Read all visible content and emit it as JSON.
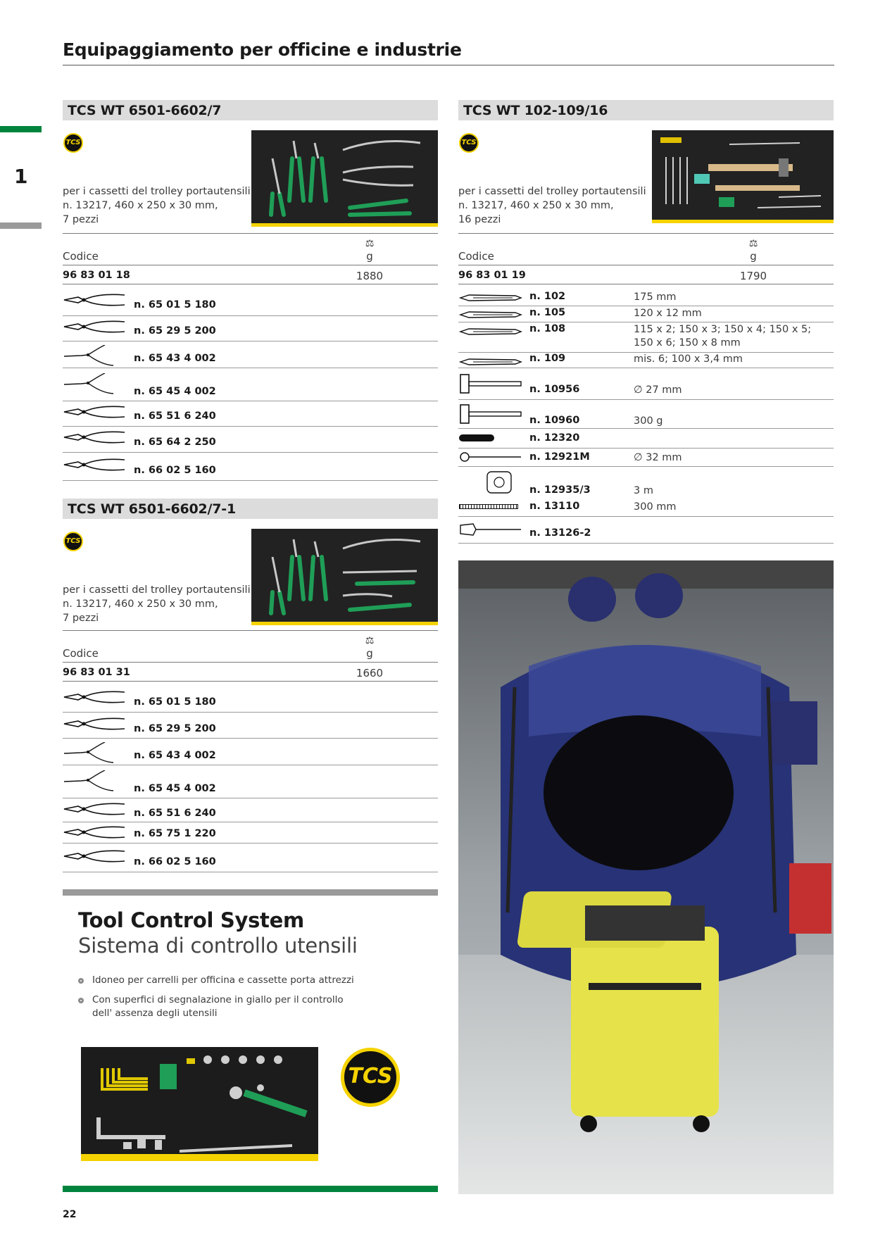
{
  "page": {
    "title": "Equipaggiamento per officine e industrie",
    "chapter": "1",
    "page_number": "22"
  },
  "colors": {
    "accent_green": "#00843d",
    "tcs_yellow": "#f5d300",
    "header_gray": "#dcdcdc"
  },
  "badge_text": "TCS",
  "sets": [
    {
      "heading": "TCS WT 6501-6602/7",
      "description": "per i cassetti del trolley portautensili\nn. 13217, 460 x 250 x 30 mm,\n7 pezzi",
      "codice_label": "Codice",
      "unit": "g",
      "code": "96 83 01 18",
      "weight": "1880",
      "items": [
        {
          "icon": "combination-pliers-icon",
          "ref": "n. 65 01 5 180"
        },
        {
          "icon": "long-nose-pliers-icon",
          "ref": "n. 65 29 5 200"
        },
        {
          "icon": "circlip-pliers-icon",
          "ref": "n. 65 43 4 002"
        },
        {
          "icon": "circlip-pliers-icon",
          "ref": "n. 65 45 4 002"
        },
        {
          "icon": "water-pump-pliers-icon",
          "ref": "n. 65 51 6 240"
        },
        {
          "icon": "locking-pliers-icon",
          "ref": "n. 65 64 2 250"
        },
        {
          "icon": "side-cutter-icon",
          "ref": "n. 66 02 5 160"
        }
      ]
    },
    {
      "heading": "TCS WT 6501-6602/7-1",
      "description": "per i cassetti del trolley portautensili\nn. 13217, 460 x 250 x 30 mm,\n7 pezzi",
      "codice_label": "Codice",
      "unit": "g",
      "code": "96 83 01 31",
      "weight": "1660",
      "items": [
        {
          "icon": "combination-pliers-icon",
          "ref": "n. 65 01 5 180"
        },
        {
          "icon": "long-nose-pliers-icon",
          "ref": "n. 65 29 5 200"
        },
        {
          "icon": "circlip-pliers-icon",
          "ref": "n. 65 43 4 002"
        },
        {
          "icon": "circlip-pliers-icon",
          "ref": "n. 65 45 4 002"
        },
        {
          "icon": "water-pump-pliers-icon",
          "ref": "n. 65 51 6 240"
        },
        {
          "icon": "stripping-pliers-icon",
          "ref": "n. 65 75 1 220"
        },
        {
          "icon": "side-cutter-icon",
          "ref": "n. 66 02 5 160"
        }
      ]
    },
    {
      "heading": "TCS WT 102-109/16",
      "description": "per i cassetti del trolley portautensili\nn. 13217, 460 x 250 x 30 mm,\n16 pezzi",
      "codice_label": "Codice",
      "unit": "g",
      "code": "96 83 01 19",
      "weight": "1790",
      "items": [
        {
          "icon": "chisel-icon",
          "ref": "n. 102",
          "spec": "175 mm"
        },
        {
          "icon": "flat-chisel-icon",
          "ref": "n. 105",
          "spec": "120 x 12 mm"
        },
        {
          "icon": "punch-icon",
          "ref": "n. 108",
          "spec": "115 x 2; 150 x 3; 150 x 4; 150 x 5;\n150 x 6; 150 x 8 mm"
        },
        {
          "icon": "center-punch-icon",
          "ref": "n. 109",
          "spec": "mis. 6; 100 x 3,4 mm"
        },
        {
          "icon": "soft-face-hammer-icon",
          "ref": "n. 10956",
          "spec": "∅ 27 mm"
        },
        {
          "icon": "machinist-hammer-icon",
          "ref": "n. 10960",
          "spec": "300 g"
        },
        {
          "icon": "pocket-knife-icon",
          "ref": "n. 12320",
          "spec": ""
        },
        {
          "icon": "magnetic-pickup-icon",
          "ref": "n. 12921M",
          "spec": "∅ 32 mm"
        },
        {
          "icon": "tape-measure-icon",
          "ref": "n. 12935/3",
          "spec": "3 m"
        },
        {
          "icon": "steel-ruler-icon",
          "ref": "n. 13110",
          "spec": "300 mm"
        },
        {
          "icon": "scriber-icon",
          "ref": "n. 13126-2",
          "spec": ""
        }
      ]
    }
  ],
  "promo": {
    "title": "Tool Control System",
    "subtitle": "Sistema di controllo utensili",
    "bullets": [
      "Idoneo per carrelli per officina e cassette porta attrezzi",
      "Con superfici di segnalazione in giallo per il controllo\ndell' assenza degli utensili"
    ],
    "logo_text": "TCS"
  }
}
